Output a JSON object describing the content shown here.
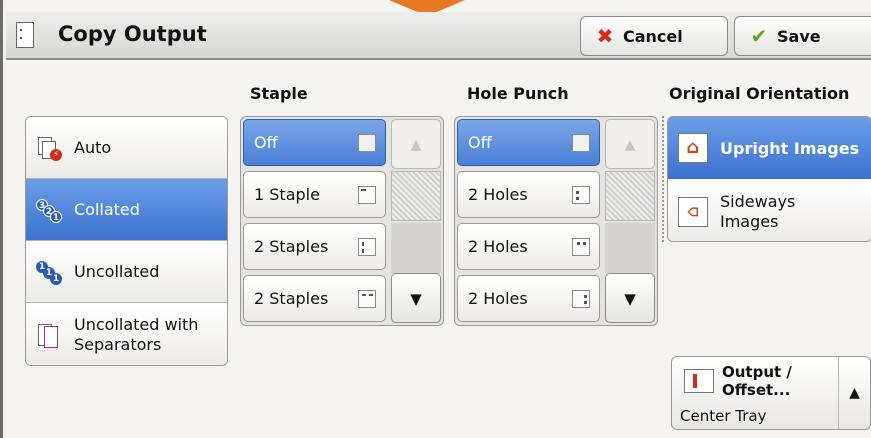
{
  "header": {
    "title": "Copy Output",
    "cancel_label": "Cancel",
    "save_label": "Save"
  },
  "sort": {
    "items": [
      {
        "label": "Auto"
      },
      {
        "label": "Collated",
        "selected": true
      },
      {
        "label": "Uncollated"
      },
      {
        "label": "Uncollated with",
        "label2": "Separators"
      }
    ]
  },
  "staple": {
    "heading": "Staple",
    "options": [
      {
        "label": "Off",
        "selected": true
      },
      {
        "label": "1 Staple"
      },
      {
        "label": "2 Staples"
      },
      {
        "label": "2 Staples"
      }
    ]
  },
  "hole_punch": {
    "heading": "Hole Punch",
    "options": [
      {
        "label": "Off",
        "selected": true
      },
      {
        "label": "2 Holes"
      },
      {
        "label": "2 Holes"
      },
      {
        "label": "2 Holes"
      }
    ]
  },
  "orientation": {
    "heading": "Original Orientation",
    "items": [
      {
        "label": "Upright Images",
        "selected": true
      },
      {
        "label": "Sideways",
        "label2": "Images"
      }
    ]
  },
  "output": {
    "label": "Output /",
    "label2": "Offset...",
    "value": "Center Tray"
  },
  "colors": {
    "accent_orange": "#e87722",
    "selected_blue": "#4a7fd6",
    "cancel_red": "#d42a1a",
    "save_green": "#5caa22"
  }
}
